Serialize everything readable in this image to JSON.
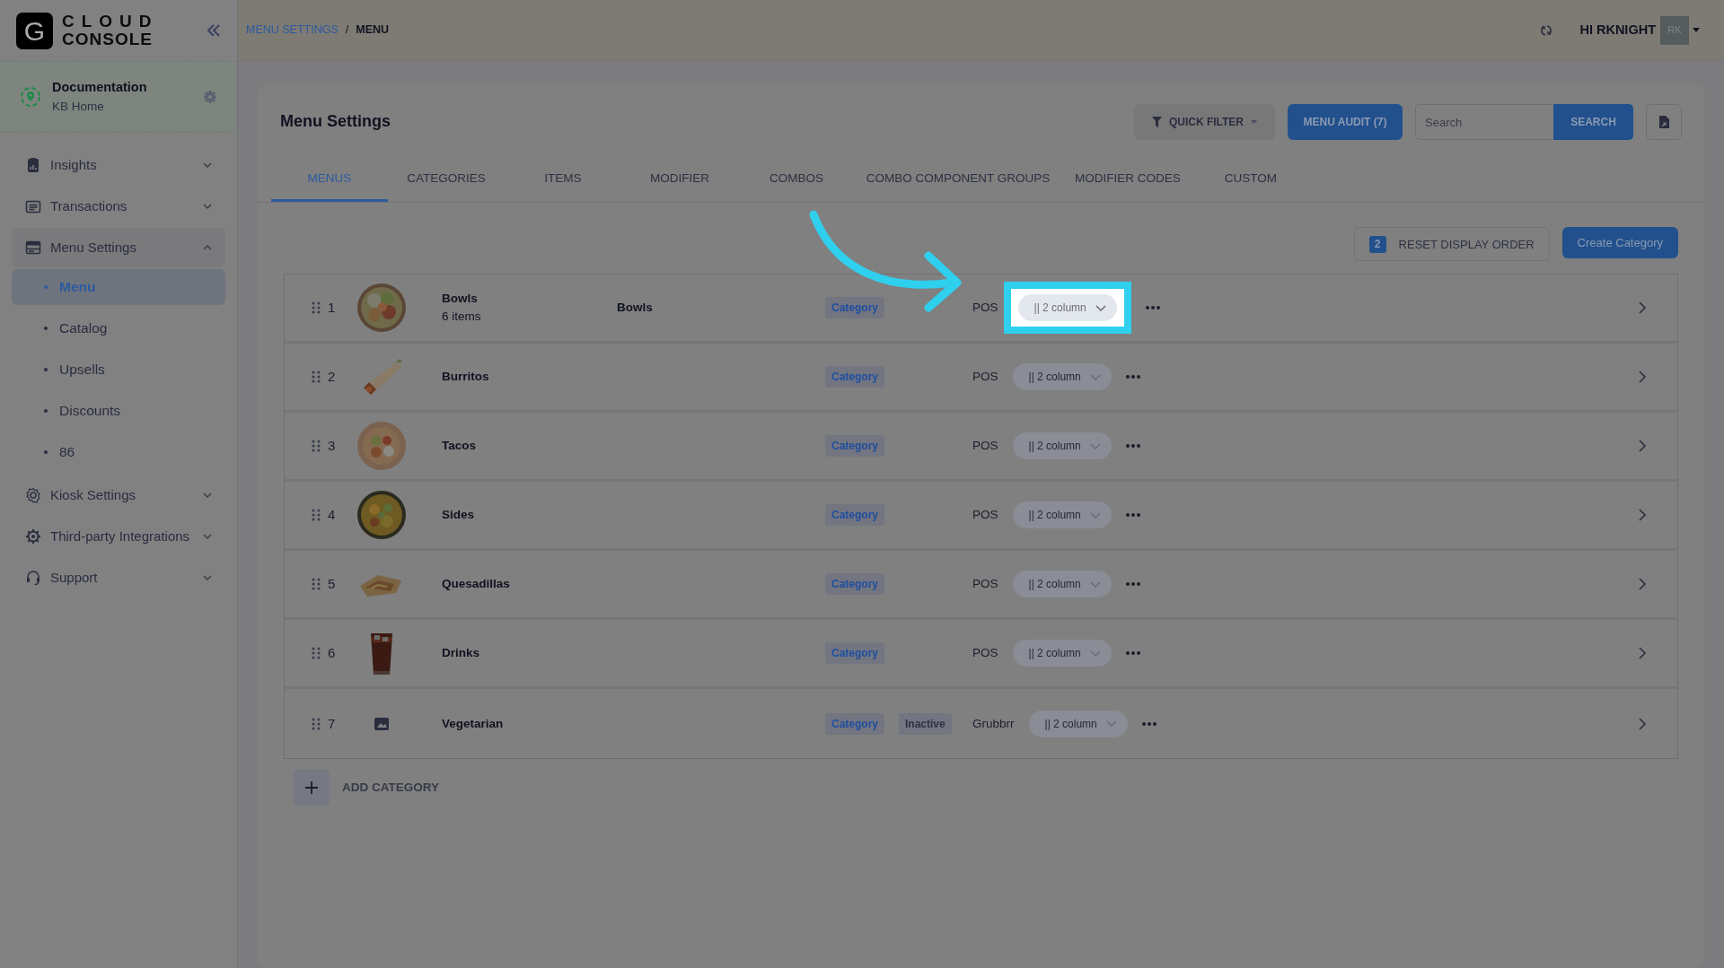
{
  "brand": {
    "letter": "G",
    "line1": "CLOUD",
    "line2": "CONSOLE"
  },
  "location": {
    "name": "Documentation",
    "subtitle": "KB Home"
  },
  "sidebar": {
    "items": [
      {
        "label": "Insights",
        "expanded": false
      },
      {
        "label": "Transactions",
        "expanded": false
      },
      {
        "label": "Menu Settings",
        "expanded": true,
        "children": [
          {
            "label": "Menu",
            "selected": true
          },
          {
            "label": "Catalog",
            "selected": false
          },
          {
            "label": "Upsells",
            "selected": false
          },
          {
            "label": "Discounts",
            "selected": false
          },
          {
            "label": "86",
            "selected": false
          }
        ]
      },
      {
        "label": "Kiosk Settings",
        "expanded": false
      },
      {
        "label": "Third-party Integrations",
        "expanded": false
      },
      {
        "label": "Support",
        "expanded": false
      }
    ]
  },
  "breadcrumb": [
    {
      "label": "MENU SETTINGS",
      "kind": "link"
    },
    {
      "label": "MENU",
      "kind": "current"
    }
  ],
  "breadcrumb_separator": "/",
  "user": {
    "greeting": "HI RKNIGHT",
    "initials": "RK"
  },
  "page_title": "Menu Settings",
  "toolbar": {
    "quick_filter": "QUICK FILTER",
    "audit": "MENU AUDIT (7)",
    "search_placeholder": "Search",
    "search_button": "SEARCH"
  },
  "tabs": [
    {
      "label": "MENUS",
      "selected": true
    },
    {
      "label": "CATEGORIES",
      "selected": false
    },
    {
      "label": "ITEMS",
      "selected": false
    },
    {
      "label": "MODIFIER",
      "selected": false
    },
    {
      "label": "COMBOS",
      "selected": false
    },
    {
      "label": "COMBO COMPONENT GROUPS",
      "selected": false
    },
    {
      "label": "MODIFIER CODES",
      "selected": false
    },
    {
      "label": "CUSTOM",
      "selected": false
    }
  ],
  "reset": {
    "count": "2",
    "label": "RESET DISPLAY ORDER"
  },
  "create_button": "Create Category",
  "rows": [
    {
      "number": "1",
      "name": "Bowls",
      "subtitle": "6 items",
      "label": "Bowls",
      "photo": true,
      "tags": [
        {
          "text": "Category",
          "kind": "type"
        }
      ],
      "source": "POS",
      "layout": "|| 2 column",
      "spotlight": true
    },
    {
      "number": "2",
      "name": "Burritos",
      "photo": true,
      "tags": [
        {
          "text": "Category",
          "kind": "type"
        }
      ],
      "source": "POS",
      "layout": "|| 2 column",
      "spotlight": false
    },
    {
      "number": "3",
      "name": "Tacos",
      "photo": true,
      "tags": [
        {
          "text": "Category",
          "kind": "type"
        }
      ],
      "source": "POS",
      "layout": "|| 2 column",
      "spotlight": false
    },
    {
      "number": "4",
      "name": "Sides",
      "photo": true,
      "tags": [
        {
          "text": "Category",
          "kind": "type"
        }
      ],
      "source": "POS",
      "layout": "|| 2 column",
      "spotlight": false
    },
    {
      "number": "5",
      "name": "Quesadillas",
      "photo": true,
      "tags": [
        {
          "text": "Category",
          "kind": "type"
        }
      ],
      "source": "POS",
      "layout": "|| 2 column",
      "spotlight": false
    },
    {
      "number": "6",
      "name": "Drinks",
      "photo": true,
      "tags": [
        {
          "text": "Category",
          "kind": "type"
        }
      ],
      "source": "POS",
      "layout": "|| 2 column",
      "spotlight": false
    },
    {
      "number": "7",
      "name": "Vegetarian",
      "photo": false,
      "tags": [
        {
          "text": "Category",
          "kind": "type"
        },
        {
          "text": "Inactive",
          "kind": "status"
        }
      ],
      "source": "Grubbrr",
      "layout": "|| 2 column",
      "spotlight": false
    }
  ],
  "add_category": "ADD CATEGORY"
}
